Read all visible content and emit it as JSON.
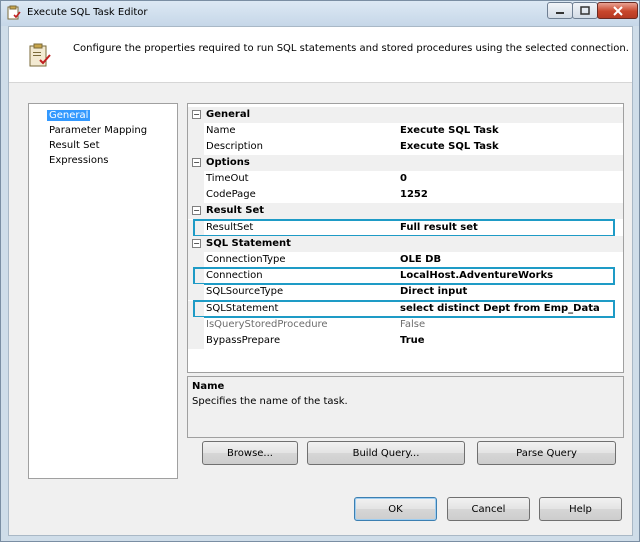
{
  "window": {
    "title": "Execute SQL Task Editor",
    "header_text": "Configure the properties required to run SQL statements and stored procedures using the selected connection."
  },
  "nav": {
    "items": [
      {
        "label": "General",
        "selected": true
      },
      {
        "label": "Parameter Mapping",
        "selected": false
      },
      {
        "label": "Result Set",
        "selected": false
      },
      {
        "label": "Expressions",
        "selected": false
      }
    ]
  },
  "grid": {
    "general": {
      "category": "General",
      "name_label": "Name",
      "name_value": "Execute SQL Task",
      "description_label": "Description",
      "description_value": "Execute SQL Task"
    },
    "options": {
      "category": "Options",
      "timeout_label": "TimeOut",
      "timeout_value": "0",
      "codepage_label": "CodePage",
      "codepage_value": "1252"
    },
    "result_set": {
      "category": "Result Set",
      "resultset_label": "ResultSet",
      "resultset_value": "Full result set"
    },
    "sql_statement": {
      "category": "SQL Statement",
      "connectiontype_label": "ConnectionType",
      "connectiontype_value": "OLE DB",
      "connection_label": "Connection",
      "connection_value": "LocalHost.AdventureWorks",
      "sqlsourcetype_label": "SQLSourceType",
      "sqlsourcetype_value": "Direct input",
      "sqlstatement_label": "SQLStatement",
      "sqlstatement_value": "select distinct Dept from Emp_Data",
      "isquerystored_label": "IsQueryStoredProcedure",
      "isquerystored_value": "False",
      "bypassprepare_label": "BypassPrepare",
      "bypassprepare_value": "True"
    },
    "expander_symbol": "⊟"
  },
  "description": {
    "title": "Name",
    "text": "Specifies the name of the task."
  },
  "buttons": {
    "browse": "Browse...",
    "build_query": "Build Query...",
    "parse_query": "Parse Query",
    "ok": "OK",
    "cancel": "Cancel",
    "help": "Help"
  },
  "colors": {
    "highlight_box": "#1e9bc6",
    "selection": "#3399ff",
    "close_button": "#c8462c"
  }
}
